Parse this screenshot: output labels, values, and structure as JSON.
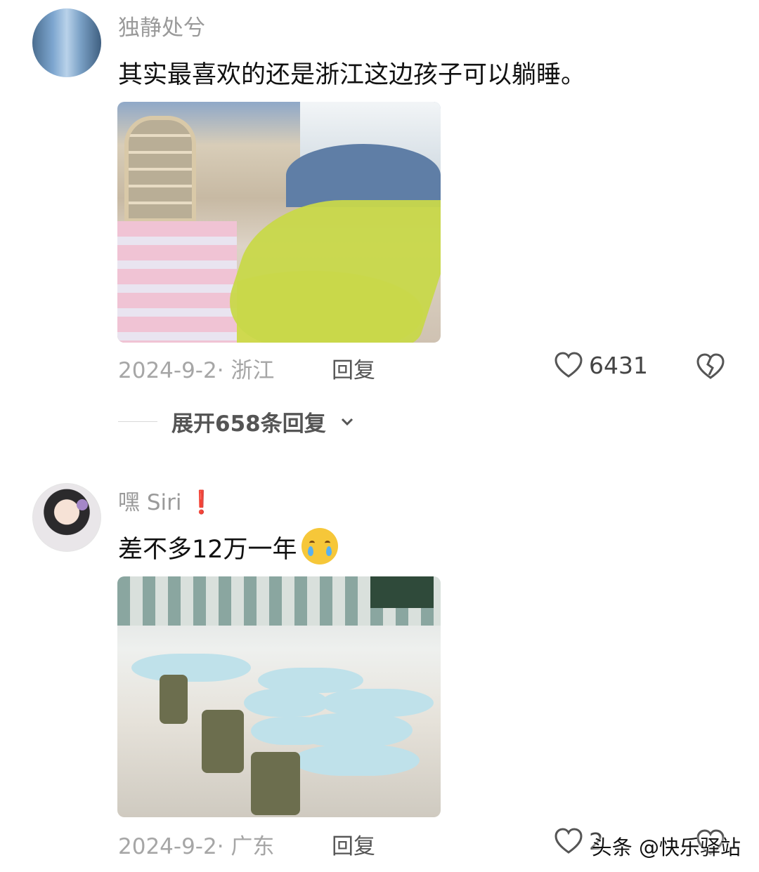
{
  "comments": [
    {
      "username": "独静处兮",
      "text": "其实最喜欢的还是浙江这边孩子可以躺睡。",
      "meta": "2024-9-2· 浙江",
      "reply_label": "回复",
      "likes": "6431"
    },
    {
      "username": "嘿 Siri",
      "badge": "❗",
      "text": "差不多12万一年",
      "emoji": "crying-face",
      "meta": "2024-9-2· 广东",
      "reply_label": "回复",
      "likes": "2"
    }
  ],
  "expand_replies": {
    "label": "展开658条回复"
  },
  "watermark": "头条 @快乐驿站",
  "colors": {
    "username": "#9a9a9a",
    "meta": "#a6a6a6",
    "badge": "#e02a2a"
  }
}
